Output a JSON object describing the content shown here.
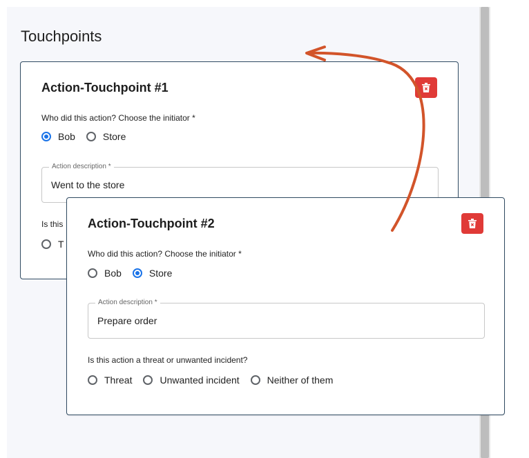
{
  "section": {
    "title": "Touchpoints"
  },
  "colors": {
    "accent": "#1a73e8",
    "delete": "#e03a37",
    "card_border": "#2f4a61",
    "arrow": "#d2542a"
  },
  "touchpoints": [
    {
      "title": "Action-Touchpoint #1",
      "initiator_question": "Who did this action? Choose the initiator *",
      "initiator_options": [
        "Bob",
        "Store"
      ],
      "selected_initiator": "Bob",
      "description_label": "Action description *",
      "description_value": "Went to the store",
      "threat_question_visible": "Is this",
      "threat_option_visible": "T",
      "delete_icon": "trash-icon"
    },
    {
      "title": "Action-Touchpoint #2",
      "initiator_question": "Who did this action? Choose the initiator *",
      "initiator_options": [
        "Bob",
        "Store"
      ],
      "selected_initiator": "Store",
      "description_label": "Action description *",
      "description_value": "Prepare order",
      "threat_question": "Is this action a threat or unwanted incident?",
      "threat_options": [
        "Threat",
        "Unwanted incident",
        "Neither of them"
      ],
      "selected_threat": null,
      "delete_icon": "trash-icon"
    }
  ]
}
